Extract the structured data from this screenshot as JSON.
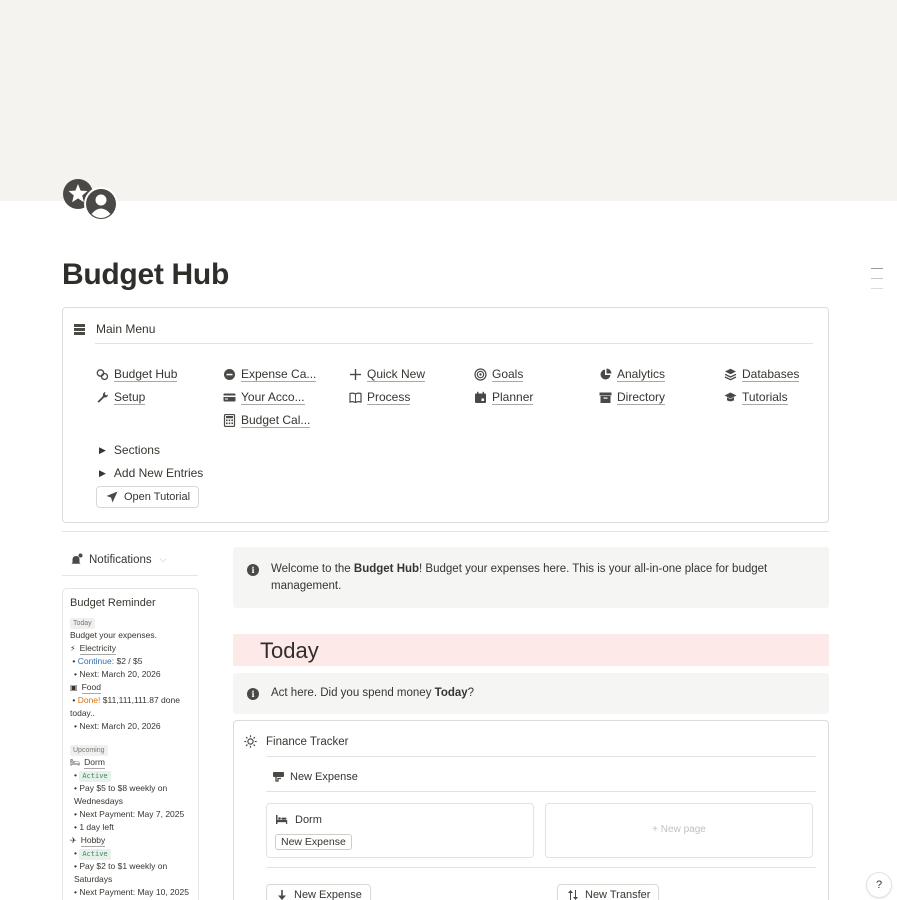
{
  "page": {
    "title": "Budget Hub",
    "icon": "star-person-icon"
  },
  "main_menu": {
    "label": "Main Menu",
    "columns": [
      [
        {
          "label": "Budget Hub",
          "icon": "coins-icon"
        },
        {
          "label": "Setup",
          "icon": "wrench-icon"
        }
      ],
      [
        {
          "label": "Expense Ca...",
          "icon": "minus-circle-icon"
        },
        {
          "label": "Your Acco...",
          "icon": "card-icon"
        },
        {
          "label": "Budget Cal...",
          "icon": "calculator-icon"
        }
      ],
      [
        {
          "label": "Quick New",
          "icon": "plus-icon"
        },
        {
          "label": "Process",
          "icon": "book-icon"
        }
      ],
      [
        {
          "label": "Goals",
          "icon": "target-icon"
        },
        {
          "label": "Planner",
          "icon": "calendar-icon"
        }
      ],
      [
        {
          "label": "Analytics",
          "icon": "pie-chart-icon"
        },
        {
          "label": "Directory",
          "icon": "archive-icon"
        }
      ],
      [
        {
          "label": "Databases",
          "icon": "stack-icon"
        },
        {
          "label": "Tutorials",
          "icon": "graduation-cap-icon"
        }
      ]
    ],
    "toggles": [
      "Sections",
      "Add New Entries"
    ],
    "tutorial_button": "Open Tutorial"
  },
  "notifications": {
    "label": "Notifications",
    "reminder": {
      "title": "Budget Reminder",
      "today_tag": "Today",
      "intro": "Budget your expenses.",
      "today_items": [
        {
          "name": "Electricity",
          "status_label": "Continue:",
          "status_value": "$2 / $5",
          "next": "• Next: March 20, 2026"
        },
        {
          "name": "Food",
          "status_label": "Done!",
          "status_value": "$11,111,111.87 done today..",
          "next": "• Next: March 20, 2026"
        }
      ],
      "upcoming_tag": "Upcoming",
      "upcoming_items": [
        {
          "name": "Dorm",
          "badge": "Active",
          "pay": "• Pay $5 to $8 weekly on Wednesdays",
          "next": "• Next Payment: May 7, 2025",
          "left": "• 1 day left"
        },
        {
          "name": "Hobby",
          "badge": "Active",
          "pay": "• Pay $2 to $1 weekly on Saturdays",
          "next": "• Next Payment: May 10, 2025"
        }
      ]
    }
  },
  "welcome": {
    "prefix": "Welcome to the ",
    "bold": "Budget Hub",
    "suffix": "! Budget your expenses here. This is your all-in-one place for budget management."
  },
  "today": {
    "heading": "Today",
    "callout_prefix": "Act here. Did you spend money ",
    "callout_bold": "Today",
    "callout_suffix": "?"
  },
  "finance_tracker": {
    "title": "Finance Tracker",
    "view_label": "New Expense",
    "card": {
      "title": "Dorm",
      "pill": "New Expense"
    },
    "new_page": "+ New page",
    "buttons": {
      "new_expense": "New Expense",
      "new_transfer": "New Transfer"
    }
  },
  "help": {
    "label": "?"
  }
}
